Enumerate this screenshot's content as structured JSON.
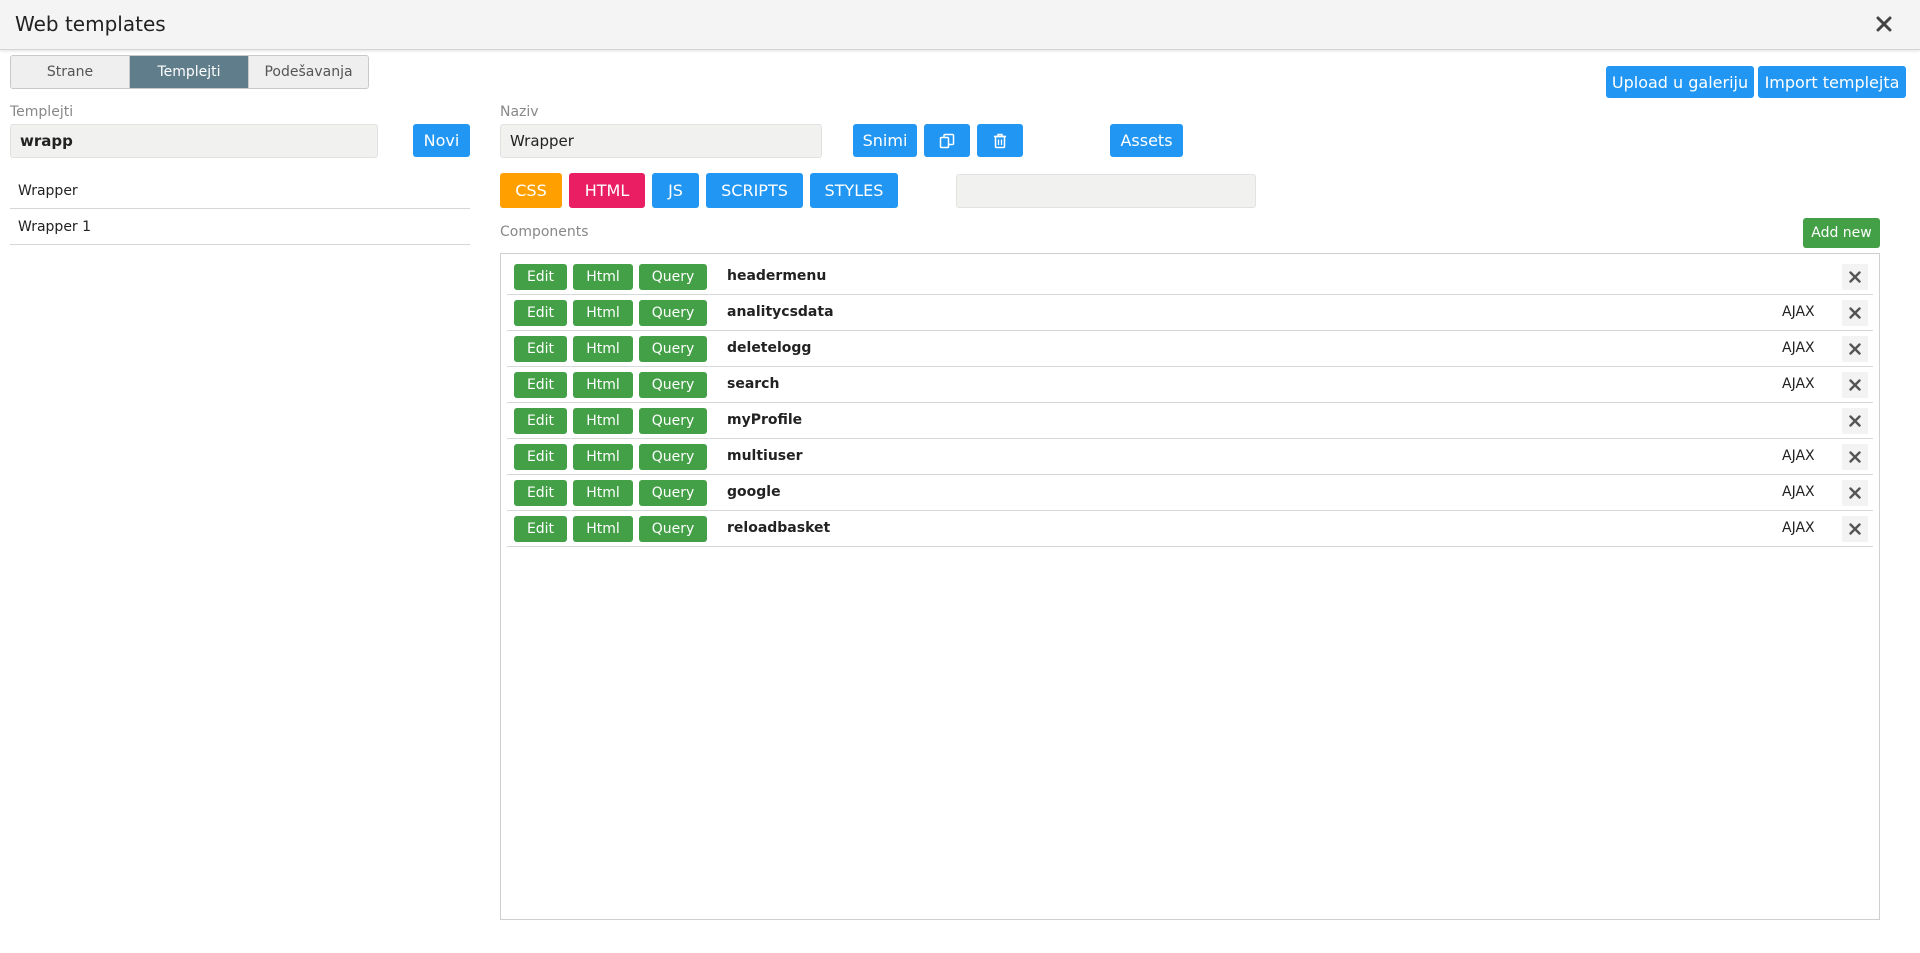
{
  "window": {
    "title": "Web templates"
  },
  "tabs": [
    {
      "label": "Strane"
    },
    {
      "label": "Templejti"
    },
    {
      "label": "Podešavanja"
    }
  ],
  "header_buttons": {
    "upload": "Upload u galeriju",
    "import": "Import templejta"
  },
  "templates": {
    "label": "Templejti",
    "search_value": "wrapp",
    "new_button": "Novi",
    "items": [
      "Wrapper",
      "Wrapper 1"
    ]
  },
  "editor": {
    "name_label": "Naziv",
    "name_value": "Wrapper",
    "save_button": "Snimi",
    "copy_icon": "copy-icon",
    "delete_icon": "trash-icon",
    "assets_button": "Assets",
    "code_buttons": {
      "css": "CSS",
      "html": "HTML",
      "js": "JS",
      "scripts": "SCRIPTS",
      "styles": "STYLES"
    },
    "filter_value": ""
  },
  "components": {
    "label": "Components",
    "add_button": "Add new",
    "edit_label": "Edit",
    "html_label": "Html",
    "query_label": "Query",
    "rows": [
      {
        "name": "headermenu",
        "type": ""
      },
      {
        "name": "analitycsdata",
        "type": "AJAX"
      },
      {
        "name": "deletelogg",
        "type": "AJAX"
      },
      {
        "name": "search",
        "type": "AJAX"
      },
      {
        "name": "myProfile",
        "type": ""
      },
      {
        "name": "multiuser",
        "type": "AJAX"
      },
      {
        "name": "google",
        "type": "AJAX"
      },
      {
        "name": "reloadbasket",
        "type": "AJAX"
      }
    ]
  },
  "colors": {
    "primary": "#2196f3",
    "success": "#43a047",
    "css": "#ffa000",
    "html": "#e91e63",
    "tab_active": "#607d8b"
  }
}
